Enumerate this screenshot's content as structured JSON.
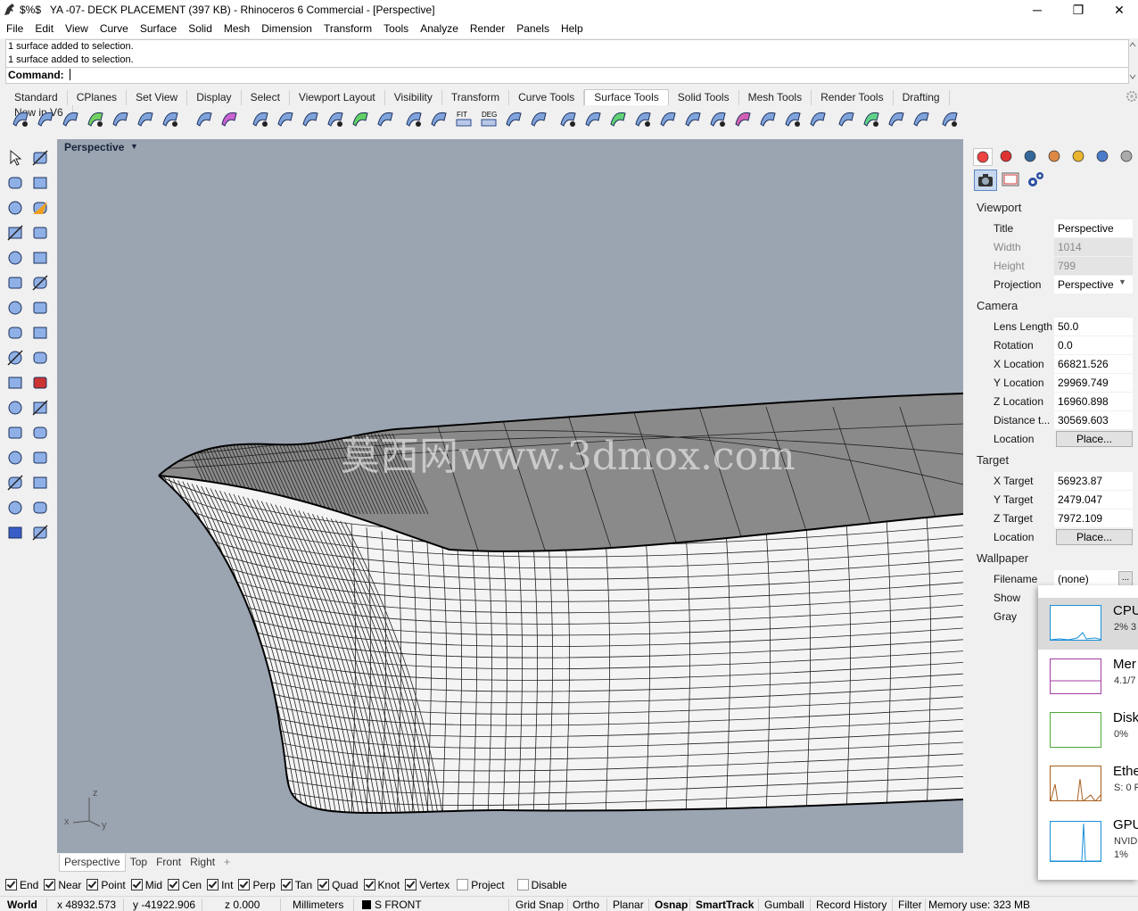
{
  "window": {
    "title": "YA -07- DECK PLACEMENT (397 KB) - Rhinoceros 6 Commercial - [Perspective]",
    "title_prefix": "$%$",
    "minimize": "─",
    "restore": "❐",
    "close": "✕"
  },
  "menu": [
    "File",
    "Edit",
    "View",
    "Curve",
    "Surface",
    "Solid",
    "Mesh",
    "Dimension",
    "Transform",
    "Tools",
    "Analyze",
    "Render",
    "Panels",
    "Help"
  ],
  "command": {
    "history": [
      "1 surface added to selection.",
      "1 surface added to selection."
    ],
    "prompt": "Command:"
  },
  "toolbar_tabs": {
    "items": [
      "Standard",
      "CPlanes",
      "Set View",
      "Display",
      "Select",
      "Viewport Layout",
      "Visibility",
      "Transform",
      "Curve Tools",
      "Surface Tools",
      "Solid Tools",
      "Mesh Tools",
      "Render Tools",
      "Drafting",
      "New in V6"
    ],
    "active": "Surface Tools"
  },
  "toolbar_icon_labels": {
    "fit": "FIT",
    "deg": "DEG"
  },
  "viewport": {
    "title": "Perspective",
    "watermark": "莫西网www.3dmox.com",
    "axes": {
      "x": "x",
      "y": "y",
      "z": "z"
    }
  },
  "viewport_tabs": {
    "items": [
      "Perspective",
      "Top",
      "Front",
      "Right"
    ],
    "active": "Perspective",
    "add": "+"
  },
  "properties": {
    "viewport_section": "Viewport",
    "title_label": "Title",
    "title_value": "Perspective",
    "width_label": "Width",
    "width_value": "1014",
    "height_label": "Height",
    "height_value": "799",
    "projection_label": "Projection",
    "projection_value": "Perspective",
    "camera_section": "Camera",
    "lens_label": "Lens Length",
    "lens_value": "50.0",
    "rotation_label": "Rotation",
    "rotation_value": "0.0",
    "xloc_label": "X Location",
    "xloc_value": "66821.526",
    "yloc_label": "Y Location",
    "yloc_value": "29969.749",
    "zloc_label": "Z Location",
    "zloc_value": "16960.898",
    "dist_label": "Distance t...",
    "dist_value": "30569.603",
    "cam_location_label": "Location",
    "cam_place_button": "Place...",
    "target_section": "Target",
    "xt_label": "X Target",
    "xt_value": "56923.87",
    "yt_label": "Y Target",
    "yt_value": "2479.047",
    "zt_label": "Z Target",
    "zt_value": "7972.109",
    "tgt_location_label": "Location",
    "tgt_place_button": "Place...",
    "wallpaper_section": "Wallpaper",
    "filename_label": "Filename",
    "filename_value": "(none)",
    "filename_button": "...",
    "show_label": "Show",
    "gray_label": "Gray"
  },
  "task_manager": [
    {
      "name": "CPU",
      "value": "2% 3"
    },
    {
      "name": "Mer",
      "value": "4.1/7"
    },
    {
      "name": "Disk",
      "value": "0%"
    },
    {
      "name": "Ethe",
      "value": "S: 0 F"
    },
    {
      "name": "GPU",
      "value": "NVID",
      "value2": "1%"
    }
  ],
  "task_manager_colors": {
    "cpu": "#1a8fd6",
    "mem": "#a43ca4",
    "disk": "#4da83a",
    "eth": "#a85d1a",
    "gpu": "#1a8fd6"
  },
  "osnaps": [
    {
      "label": "End",
      "on": true
    },
    {
      "label": "Near",
      "on": true
    },
    {
      "label": "Point",
      "on": true
    },
    {
      "label": "Mid",
      "on": true
    },
    {
      "label": "Cen",
      "on": true
    },
    {
      "label": "Int",
      "on": true
    },
    {
      "label": "Perp",
      "on": true
    },
    {
      "label": "Tan",
      "on": true
    },
    {
      "label": "Quad",
      "on": true
    },
    {
      "label": "Knot",
      "on": true
    },
    {
      "label": "Vertex",
      "on": true
    },
    {
      "label": "Project",
      "on": false
    },
    {
      "label": "Disable",
      "on": false
    }
  ],
  "status": {
    "cplane": "World",
    "x": "x 48932.573",
    "y": "y -41922.906",
    "z": "z 0.000",
    "units": "Millimeters",
    "layer": "S FRONT",
    "grid_snap": "Grid Snap",
    "ortho": "Ortho",
    "planar": "Planar",
    "osnap": "Osnap",
    "smarttrack": "SmartTrack",
    "gumball": "Gumball",
    "record_history": "Record History",
    "filter": "Filter",
    "memory": "Memory use: 323 MB"
  }
}
